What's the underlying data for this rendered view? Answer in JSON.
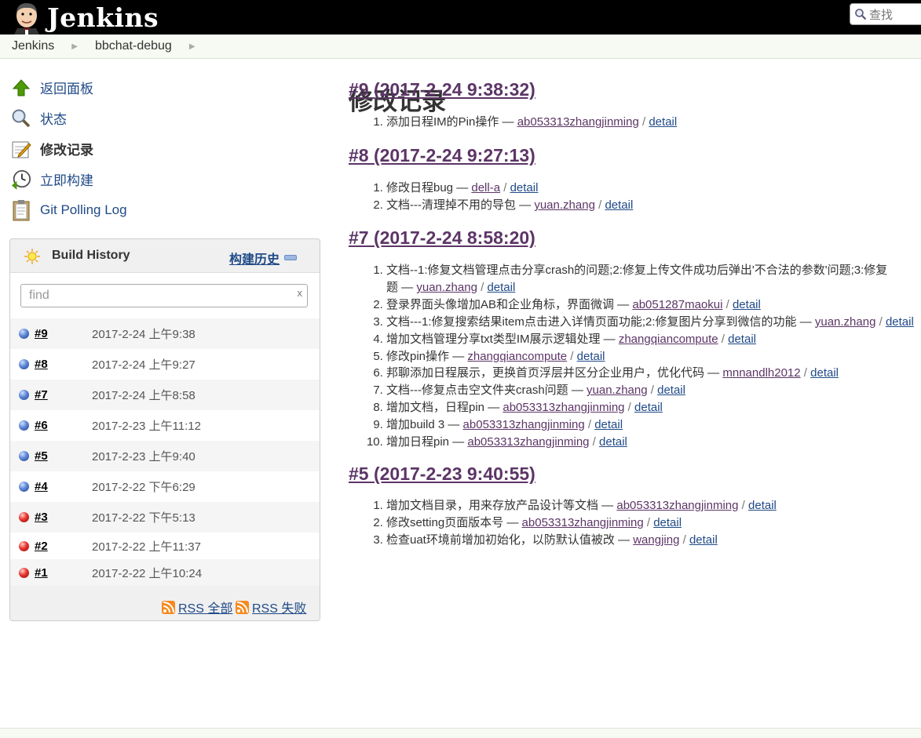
{
  "header": {
    "app_name": "Jenkins",
    "search_placeholder": "查找"
  },
  "breadcrumbs": [
    "Jenkins",
    "bbchat-debug"
  ],
  "tasks": [
    {
      "label": "返回面板",
      "icon": "up-arrow-icon"
    },
    {
      "label": "状态",
      "icon": "magnifier-icon"
    },
    {
      "label": "修改记录",
      "icon": "notepad-icon"
    },
    {
      "label": "立即构建",
      "icon": "clock-build-icon"
    },
    {
      "label": "Git Polling Log",
      "icon": "clipboard-icon"
    }
  ],
  "build_history": {
    "title": "Build History",
    "trend_label": "构建历史",
    "filter_placeholder": "find",
    "clear_label": "x",
    "builds": [
      {
        "num": "#9",
        "date": "2017-2-24 上午9:38",
        "status": "blue"
      },
      {
        "num": "#8",
        "date": "2017-2-24 上午9:27",
        "status": "blue"
      },
      {
        "num": "#7",
        "date": "2017-2-24 上午8:58",
        "status": "blue"
      },
      {
        "num": "#6",
        "date": "2017-2-23 上午11:12",
        "status": "blue"
      },
      {
        "num": "#5",
        "date": "2017-2-23 上午9:40",
        "status": "blue"
      },
      {
        "num": "#4",
        "date": "2017-2-22 下午6:29",
        "status": "blue"
      },
      {
        "num": "#3",
        "date": "2017-2-22 下午5:13",
        "status": "red"
      },
      {
        "num": "#2",
        "date": "2017-2-22 上午11:37",
        "status": "red"
      },
      {
        "num": "#1",
        "date": "2017-2-22 上午10:24",
        "status": "red"
      }
    ],
    "rss_all": "RSS 全部",
    "rss_failed": "RSS 失败"
  },
  "main": {
    "title": "修改记录",
    "sep": " — ",
    "slash": " / ",
    "detail_label": "detail",
    "changes": [
      {
        "heading": "#9 (2017-2-24 9:38:32)",
        "items": [
          {
            "msg": "添加日程IM的Pin操作",
            "user": "ab053313zhangjinming"
          }
        ]
      },
      {
        "heading": "#8 (2017-2-24 9:27:13)",
        "items": [
          {
            "msg": "修改日程bug",
            "user": "dell-a"
          },
          {
            "msg": "文档---清理掉不用的导包",
            "user": "yuan.zhang"
          }
        ]
      },
      {
        "heading": "#7 (2017-2-24 8:58:20)",
        "items": [
          {
            "msg": "文档--1:修复文档管理点击分享crash的问题;2:修复上传文件成功后弹出'不合法的参数'问题;3:修复",
            "msg2": "题",
            "user": "yuan.zhang"
          },
          {
            "msg": "登录界面头像增加AB和企业角标，界面微调",
            "user": "ab051287maokui"
          },
          {
            "msg": "文档---1:修复搜索结果item点击进入详情页面功能;2:修复图片分享到微信的功能",
            "user": "yuan.zhang"
          },
          {
            "msg": "增加文档管理分享txt类型IM展示逻辑处理",
            "user": "zhangqiancompute"
          },
          {
            "msg": "修改pin操作",
            "user": "zhangqiancompute"
          },
          {
            "msg": "邦聊添加日程展示，更换首页浮层并区分企业用户，优化代码",
            "user": "mnnandlh2012"
          },
          {
            "msg": "文档---修复点击空文件夹crash问题",
            "user": "yuan.zhang"
          },
          {
            "msg": "增加文档，日程pin",
            "user": "ab053313zhangjinming"
          },
          {
            "msg": "增加build 3",
            "user": "ab053313zhangjinming"
          },
          {
            "msg": "增加日程pin",
            "user": "ab053313zhangjinming"
          }
        ]
      },
      {
        "heading": "#5 (2017-2-23 9:40:55)",
        "items": [
          {
            "msg": "增加文档目录，用来存放产品设计等文档",
            "user": "ab053313zhangjinming"
          },
          {
            "msg": "修改setting页面版本号",
            "user": "ab053313zhangjinming"
          },
          {
            "msg": "检查uat环境前增加初始化，以防默认值被改",
            "user": "wangjing"
          }
        ]
      }
    ]
  }
}
